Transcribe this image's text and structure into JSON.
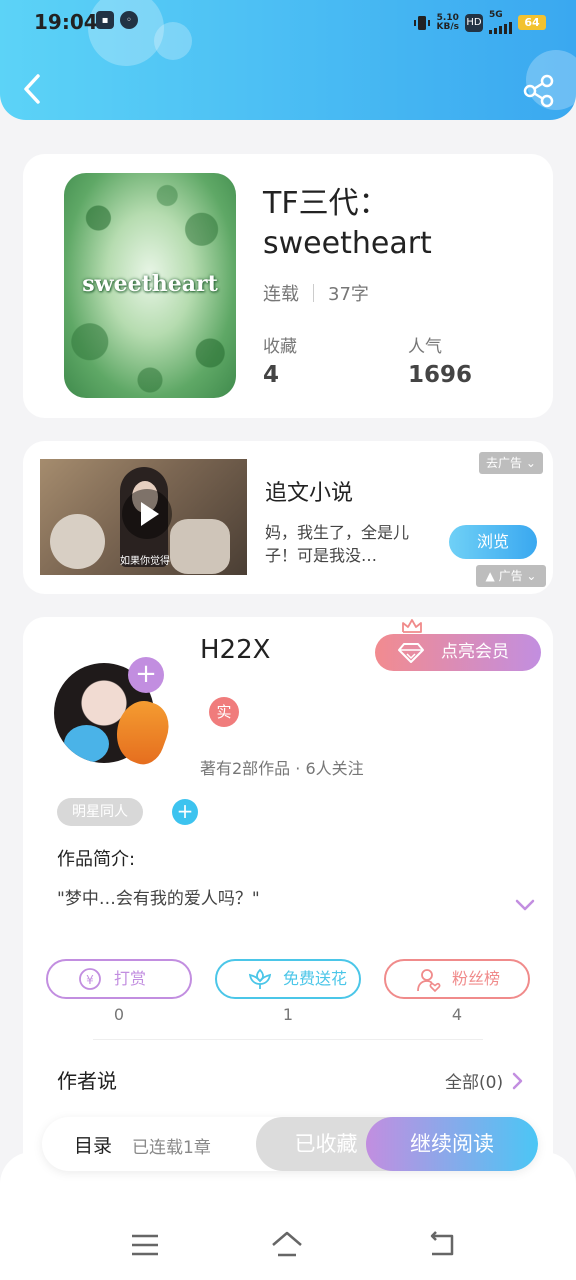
{
  "status_bar": {
    "time": "19:04",
    "net_speed_value": "5.10",
    "net_speed_unit": "KB/s",
    "hd_label": "HD",
    "network": "5G",
    "battery": "64"
  },
  "book": {
    "cover_text": "sweetheart",
    "title": "TF三代：sweetheart",
    "status": "连载",
    "word_count": "37字",
    "favorites_label": "收藏",
    "favorites_value": "4",
    "popularity_label": "人气",
    "popularity_value": "1696"
  },
  "ad": {
    "video_caption": "如果你觉得",
    "title": "追文小说",
    "description": "妈，我生了，全是儿子！可是我没…",
    "browse_label": "浏览",
    "remove_ads_label": "去广告",
    "ad_tag": "广告"
  },
  "author": {
    "name": "H22X",
    "real_badge": "实",
    "meta": "著有2部作品 · 6人关注",
    "vip_label": "点亮会员",
    "follow_plus": "+",
    "tag": "明星同人",
    "tag_add": "+",
    "intro_label": "作品简介:",
    "intro_text": "\"梦中…会有我的爱人吗？\"",
    "actions": [
      {
        "label": "打赏",
        "count": "0",
        "color": "#c28ee0"
      },
      {
        "label": "免费送花",
        "count": "1",
        "color": "#4bc6e8"
      },
      {
        "label": "粉丝榜",
        "count": "4",
        "color": "#f08b8b"
      }
    ],
    "author_says_label": "作者说",
    "all_label": "全部(0)"
  },
  "bottom_bar": {
    "toc_label": "目录",
    "toc_meta": "已连载1章",
    "collected_label": "已收藏",
    "continue_label": "继续阅读"
  },
  "nav_icons": [
    "menu-icon",
    "home-icon",
    "back-icon"
  ]
}
